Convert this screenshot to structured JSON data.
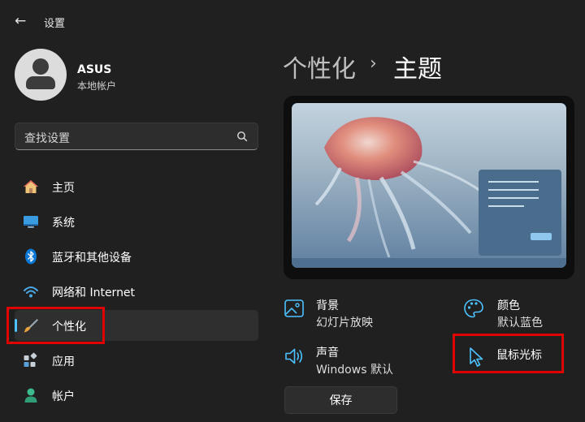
{
  "window": {
    "title": "设置"
  },
  "account": {
    "name": "ASUS",
    "type": "本地帐户"
  },
  "search": {
    "placeholder": "查找设置"
  },
  "nav": [
    {
      "label": "主页",
      "icon": "home-icon"
    },
    {
      "label": "系统",
      "icon": "system-display-icon"
    },
    {
      "label": "蓝牙和其他设备",
      "icon": "bluetooth-icon"
    },
    {
      "label": "网络和 Internet",
      "icon": "wifi-icon"
    },
    {
      "label": "个性化",
      "icon": "paintbrush-icon",
      "selected": true
    },
    {
      "label": "应用",
      "icon": "apps-icon"
    },
    {
      "label": "帐户",
      "icon": "account-icon"
    }
  ],
  "breadcrumb": {
    "parent": "个性化",
    "separator": "›",
    "current": "主题"
  },
  "options": {
    "background": {
      "title": "背景",
      "value": "幻灯片放映"
    },
    "color": {
      "title": "颜色",
      "value": "默认蓝色"
    },
    "sound": {
      "title": "声音",
      "value": "Windows 默认"
    },
    "cursor": {
      "title": "鼠标光标"
    }
  },
  "save_label": "保存",
  "colors": {
    "accent": "#4cc2ff",
    "highlight": "#e00000",
    "background": "#202020"
  }
}
